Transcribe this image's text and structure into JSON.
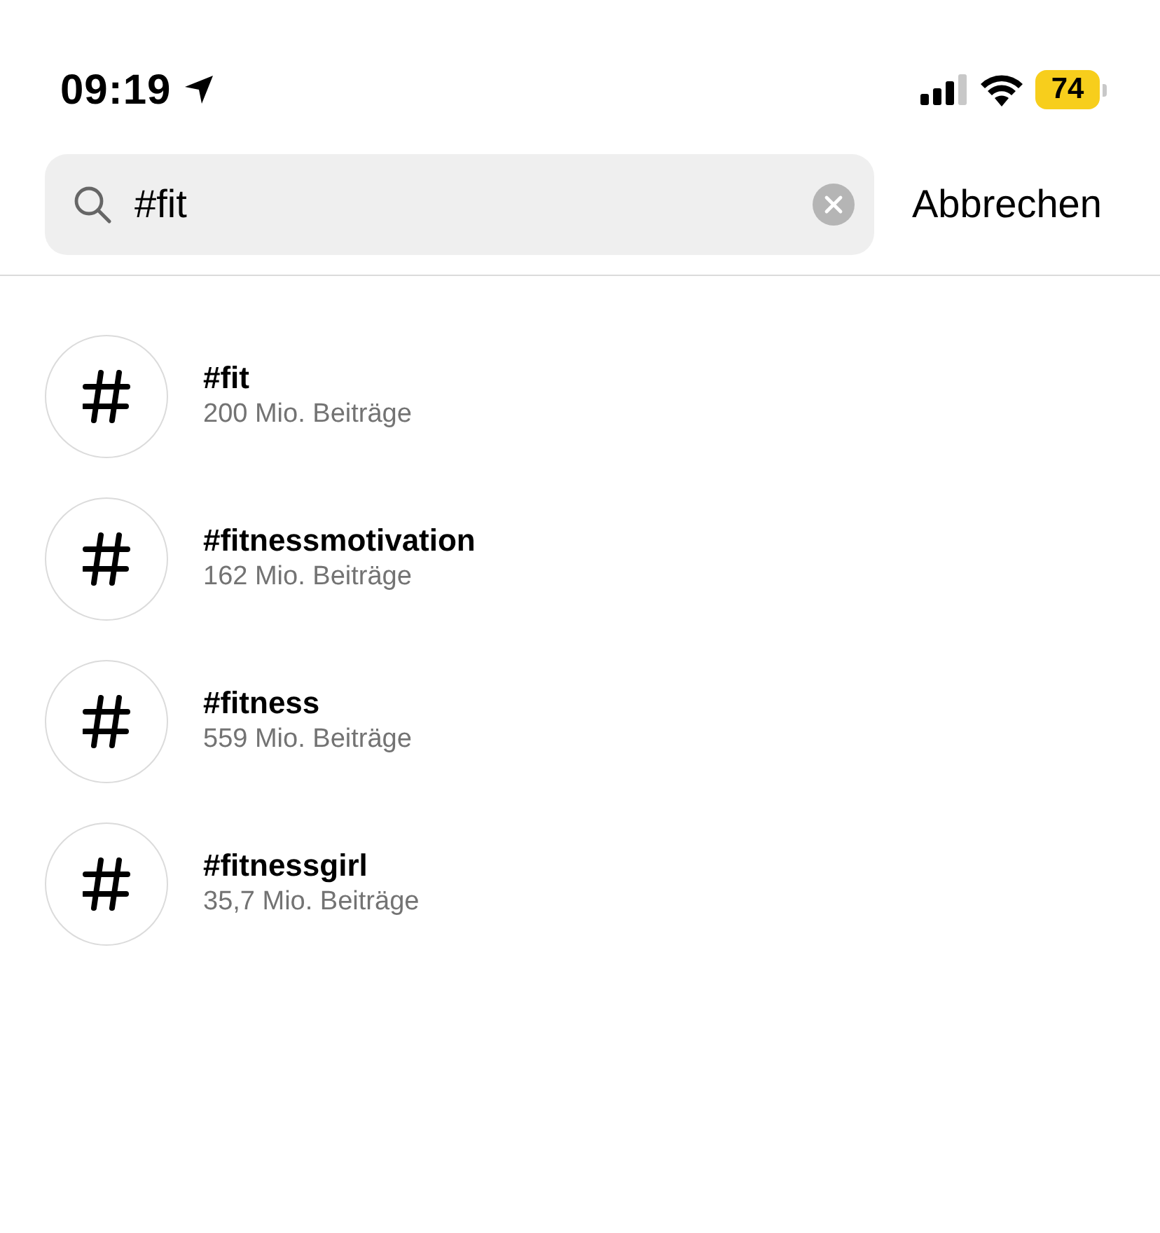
{
  "status_bar": {
    "time": "09:19",
    "battery": "74"
  },
  "search": {
    "value": "#fit",
    "cancel": "Abbrechen"
  },
  "results": [
    {
      "tag": "#fit",
      "posts": "200 Mio. Beiträge"
    },
    {
      "tag": "#fitnessmotivation",
      "posts": "162 Mio. Beiträge"
    },
    {
      "tag": "#fitness",
      "posts": "559 Mio. Beiträge"
    },
    {
      "tag": "#fitnessgirl",
      "posts": "35,7 Mio. Beiträge"
    }
  ]
}
